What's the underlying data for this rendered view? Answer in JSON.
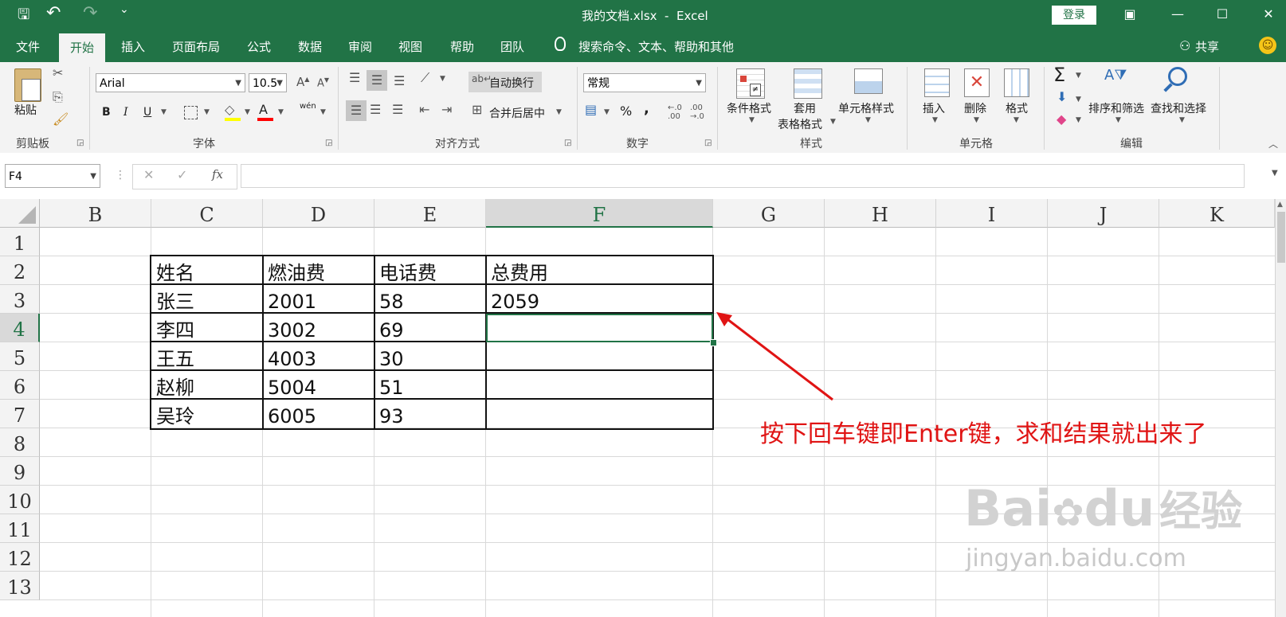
{
  "window": {
    "title": "我的文档.xlsx  -  Excel",
    "login_label": "登录",
    "minimize_icon": "—",
    "restore_icon": "☐",
    "close_icon": "✕",
    "ribbon_opts_icon": "▣"
  },
  "qat": {
    "save": "🖫",
    "undo": "↶",
    "redo": "↷",
    "more": "⌄"
  },
  "tabs": [
    "文件",
    "开始",
    "插入",
    "页面布局",
    "公式",
    "数据",
    "审阅",
    "视图",
    "帮助",
    "团队"
  ],
  "tell_me": "搜索命令、文本、帮助和其他",
  "share": "共享",
  "ribbon": {
    "clipboard": {
      "paste": "粘贴",
      "label": "剪贴板"
    },
    "font": {
      "name": "Arial",
      "size": "10.5",
      "bold": "B",
      "italic": "I",
      "underline": "U",
      "label": "字体",
      "wen": "wén"
    },
    "alignment": {
      "wrap": "自动换行",
      "merge": "合并后居中",
      "label": "对齐方式"
    },
    "number": {
      "format": "常规",
      "percent": "%",
      "comma": ",",
      "label": "数字"
    },
    "styles": {
      "cond": "条件格式",
      "table_l1": "套用",
      "table_l2": "表格格式",
      "cell": "单元格样式",
      "label": "样式"
    },
    "cells": {
      "insert": "插入",
      "delete": "删除",
      "format": "格式",
      "label": "单元格"
    },
    "editing": {
      "sum": "Σ",
      "sort": "排序和筛选",
      "find": "查找和选择",
      "label": "编辑"
    }
  },
  "formula_bar": {
    "name_box": "F4",
    "cancel": "✕",
    "enter": "✓",
    "fx": "fx",
    "value": ""
  },
  "columns": [
    "B",
    "C",
    "D",
    "E",
    "F",
    "G",
    "H",
    "I",
    "J",
    "K"
  ],
  "rows": [
    "1",
    "2",
    "3",
    "4",
    "5",
    "6",
    "7",
    "8",
    "9",
    "10",
    "11",
    "12",
    "13"
  ],
  "selected_cell": "F4",
  "table": {
    "header": [
      "姓名",
      "燃油费",
      "电话费",
      "总费用"
    ],
    "rows": [
      [
        "张三",
        "2001",
        "58",
        "2059"
      ],
      [
        "李四",
        "3002",
        "69",
        ""
      ],
      [
        "王五",
        "4003",
        "30",
        ""
      ],
      [
        "赵柳",
        "5004",
        "51",
        ""
      ],
      [
        "吴玲",
        "6005",
        "93",
        ""
      ]
    ]
  },
  "annotation": "按下回车键即Enter键，求和结果就出来了",
  "watermark": {
    "brand": "Bai",
    "brand2": "du",
    "cn": "经验",
    "url": "jingyan.baidu.com"
  },
  "colors": {
    "accent": "#217346",
    "annotation": "#e01414"
  }
}
